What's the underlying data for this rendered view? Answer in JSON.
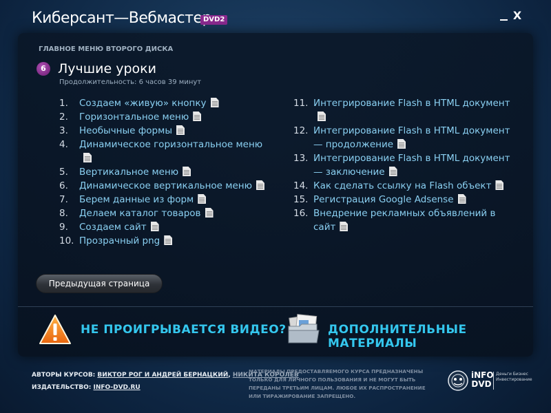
{
  "window": {
    "title": "Киберсант—Вебмастер",
    "badge": "DVD2",
    "minimize_label": "_",
    "close_label": "X"
  },
  "menu": {
    "caption": "ГЛАВНОЕ МЕНЮ ВТОРОГО ДИСКА",
    "section_number": "6",
    "section_title": "Лучшие уроки",
    "duration": "Продолжительность: 6 часов 39 минут"
  },
  "lessons_left": [
    {
      "num": "1.",
      "title": "Создаем «живую» кнопку"
    },
    {
      "num": "2.",
      "title": "Горизонтальное меню"
    },
    {
      "num": "3.",
      "title": "Необычные формы"
    },
    {
      "num": "4.",
      "title": "Динамическое горизонтальное меню"
    },
    {
      "num": "5.",
      "title": "Вертикальное меню"
    },
    {
      "num": "6.",
      "title": "Динамическое вертикальное меню"
    },
    {
      "num": "7.",
      "title": "Берем данные из форм"
    },
    {
      "num": "8.",
      "title": "Делаем каталог товаров"
    },
    {
      "num": "9.",
      "title": "Создаем сайт"
    },
    {
      "num": "10.",
      "title": "Прозрачный png"
    }
  ],
  "lessons_right": [
    {
      "num": "11.",
      "title": "Интегрирование Flash в HTML документ"
    },
    {
      "num": "12.",
      "title": "Интегрирование Flash в HTML документ — продолжение"
    },
    {
      "num": "13.",
      "title": "Интегрирование Flash в HTML документ — заключение"
    },
    {
      "num": "14.",
      "title": "Как сделать ссылку на Flash объект"
    },
    {
      "num": "15.",
      "title": "Регистрация Google Adsense"
    },
    {
      "num": "16.",
      "title": "Внедрение рекламных объявлений в сайт"
    }
  ],
  "navigation": {
    "prev_page": "Предыдущая страница"
  },
  "actions": {
    "video_problem": "НЕ ПРОИГРЫВАЕТСЯ ВИДЕО?",
    "extra_materials": "ДОПОЛНИТЕЛЬНЫЕ МАТЕРИАЛЫ"
  },
  "footer": {
    "authors_label": "АВТОРЫ КУРСОВ: ",
    "author1": "ВИКТОР РОГ И АНДРЕЙ БЕРНАЦКИЙ",
    "separator": ", ",
    "author2": "НИКИТА КОРОЛЕВ",
    "publisher_label": "ИЗДАТЕЛЬСТВО: ",
    "publisher": "INFO-DVD.RU",
    "disclaimer": "МАТЕРИАЛЫ ПРЕДОСТАВЛЯЕМОГО КУРСА ПРЕДНАЗНАЧЕНЫ ТОЛЬКО ДЛЯ ЛИЧНОГО ПОЛЬЗОВАНИЯ И НЕ МОГУТ БЫТЬ ПЕРЕДАНЫ ТРЕТЬИМ ЛИЦАМ. ЛЮБОЕ ИХ РАСПРОСТРАНЕНИЕ ИЛИ ТИРАЖИРОВАНИЕ ЗАПРЕЩЕНО.",
    "logo_word": "iNFO DVD",
    "logo_tagline": "Деньги Бизнес Инвестирование"
  },
  "colors": {
    "accent": "#34c7ee",
    "link": "#8ad0f2",
    "badge": "#8a2a8f"
  },
  "icons": {
    "document": "document-icon",
    "warning": "warning-icon",
    "folder": "folder-icon"
  }
}
